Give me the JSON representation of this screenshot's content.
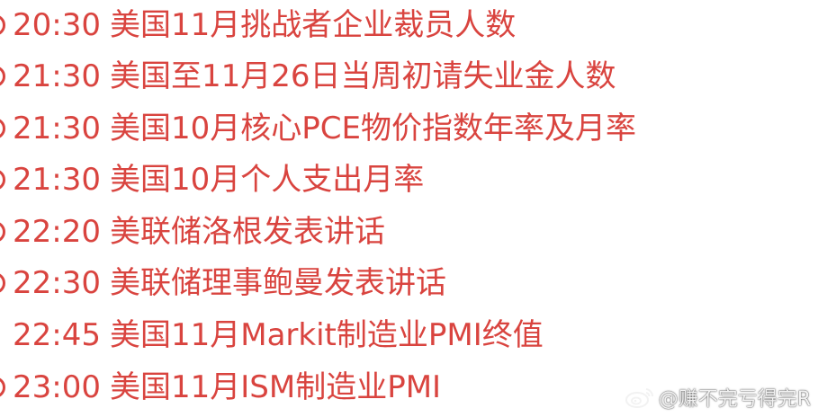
{
  "events": [
    {
      "time": "20:30",
      "event": "美国11月挑战者企业裁员人数"
    },
    {
      "time": "21:30",
      "event": "美国至11月26日当周初请失业金人数"
    },
    {
      "time": "21:30",
      "event": "美国10月核心PCE物价指数年率及月率"
    },
    {
      "time": "21:30",
      "event": "美国10月个人支出月率"
    },
    {
      "time": "22:20",
      "event": "美联储洛根发表讲话"
    },
    {
      "time": "22:30",
      "event": "美联储理事鲍曼发表讲话"
    },
    {
      "time": "22:45",
      "event": "美国11月Markit制造业PMI终值"
    },
    {
      "time": "23:00",
      "event": "美国11月ISM制造业PMI"
    }
  ],
  "watermark": {
    "text": "@赚不完亏得完R",
    "icon": "weibo-logo-icon"
  },
  "colors": {
    "text": "#d9443f",
    "background": "#ffffff"
  }
}
